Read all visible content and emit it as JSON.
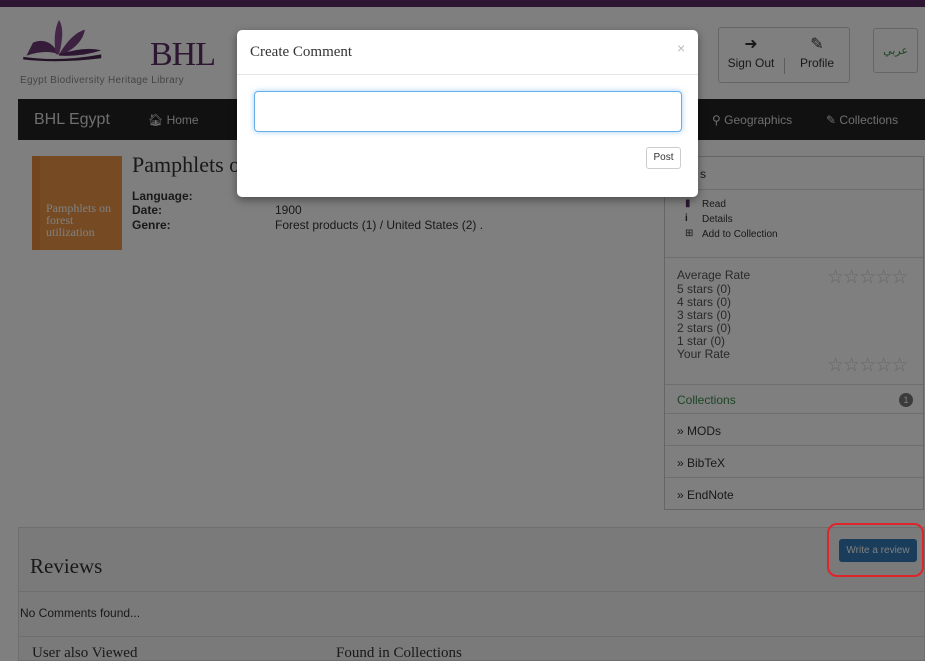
{
  "header": {
    "logo_text": "BHL",
    "logo_subtitle": "Egypt Biodiversity Heritage Library",
    "sign_out_label": "Sign Out",
    "profile_label": "Profile",
    "language_label": "عربي"
  },
  "navbar": {
    "brand": "BHL Egypt",
    "items": [
      {
        "icon": "home-icon",
        "label": "Home"
      },
      {
        "icon": "map-marker-icon",
        "label": "Geographics"
      },
      {
        "icon": "edit-icon",
        "label": "Collections"
      }
    ]
  },
  "book": {
    "cover_text": "Pamphlets on forest utilization",
    "title": "Pamphlets o",
    "meta": [
      {
        "label": "Language:",
        "value": ""
      },
      {
        "label": "Date:",
        "value": "1900"
      },
      {
        "label": "Genre:",
        "value": "Forest products (1) / United States (2) ."
      }
    ]
  },
  "sidebar": {
    "header_text": "s",
    "links": [
      {
        "icon": "book-icon",
        "label": "Read"
      },
      {
        "icon": "info-icon",
        "label": "Details"
      },
      {
        "icon": "plus-square-icon",
        "label": "Add to Collection"
      }
    ],
    "rating": {
      "average_label": "Average Rate",
      "lines": [
        "5 stars (0)",
        "4 stars (0)",
        "3 stars (0)",
        "2 stars (0)",
        "1 star (0)"
      ],
      "your_rate_label": "Your Rate",
      "average_stars": 0,
      "your_stars": 0
    },
    "collections_label": "Collections",
    "collections_count": "1",
    "exports": [
      "» MODs",
      "» BibTeX",
      "» EndNote"
    ]
  },
  "reviews": {
    "title": "Reviews",
    "write_button": "Write a review",
    "empty_text": "No Comments found..."
  },
  "bottom": {
    "user_also_viewed": "User also Viewed",
    "found_in_collections": "Found in Collections"
  },
  "modal": {
    "title": "Create Comment",
    "close": "×",
    "textarea_value": "",
    "post_label": "Post"
  },
  "colors": {
    "brand_purple": "#5b2d62",
    "navbar": "#222222",
    "primary_button": "#337ab7",
    "highlight": "#e0242b",
    "cover": "#ec9649"
  }
}
